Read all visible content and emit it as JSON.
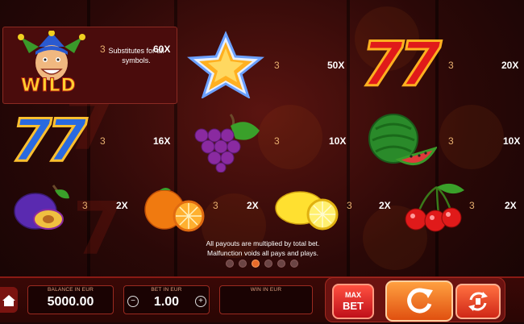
{
  "paytable": {
    "wild": {
      "icon": "jester-wild-icon",
      "logo_text": "WILD",
      "count": "3",
      "multiplier": "60X",
      "description": "Substitutes for all symbols."
    },
    "star": {
      "icon": "star-icon",
      "count": "3",
      "multiplier": "50X"
    },
    "red_seven": {
      "icon": "red-seven-icon",
      "symbol": "77",
      "count": "3",
      "multiplier": "20X"
    },
    "blue_seven": {
      "icon": "blue-seven-icon",
      "symbol": "77",
      "count": "3",
      "multiplier": "16X"
    },
    "grapes": {
      "icon": "grapes-icon",
      "count": "3",
      "multiplier": "10X"
    },
    "watermelon": {
      "icon": "watermelon-icon",
      "count": "3",
      "multiplier": "10X"
    },
    "plum": {
      "icon": "plum-icon",
      "count": "3",
      "multiplier": "2X"
    },
    "orange": {
      "icon": "orange-icon",
      "count": "3",
      "multiplier": "2X"
    },
    "lemon": {
      "icon": "lemon-icon",
      "count": "3",
      "multiplier": "2X"
    },
    "cherry": {
      "icon": "cherry-icon",
      "count": "3",
      "multiplier": "2X"
    }
  },
  "footnote": {
    "line1": "All payouts are multiplied by total bet.",
    "line2": "Malfunction voids all pays and plays."
  },
  "pagination": {
    "total": 6,
    "active": 3
  },
  "bottom_bar": {
    "balance_label": "BALANCE IN EUR",
    "balance_value": "5000.00",
    "bet_label": "BET IN EUR",
    "bet_value": "1.00",
    "bet_decrease": "−",
    "bet_increase": "+",
    "win_label": "WIN IN EUR",
    "win_value": "",
    "max_bet_line1": "MAX",
    "max_bet_line2": "BET"
  },
  "colors": {
    "accent": "#e86a2a",
    "panel": "#4a0c0c",
    "bar": "#3a0806"
  }
}
